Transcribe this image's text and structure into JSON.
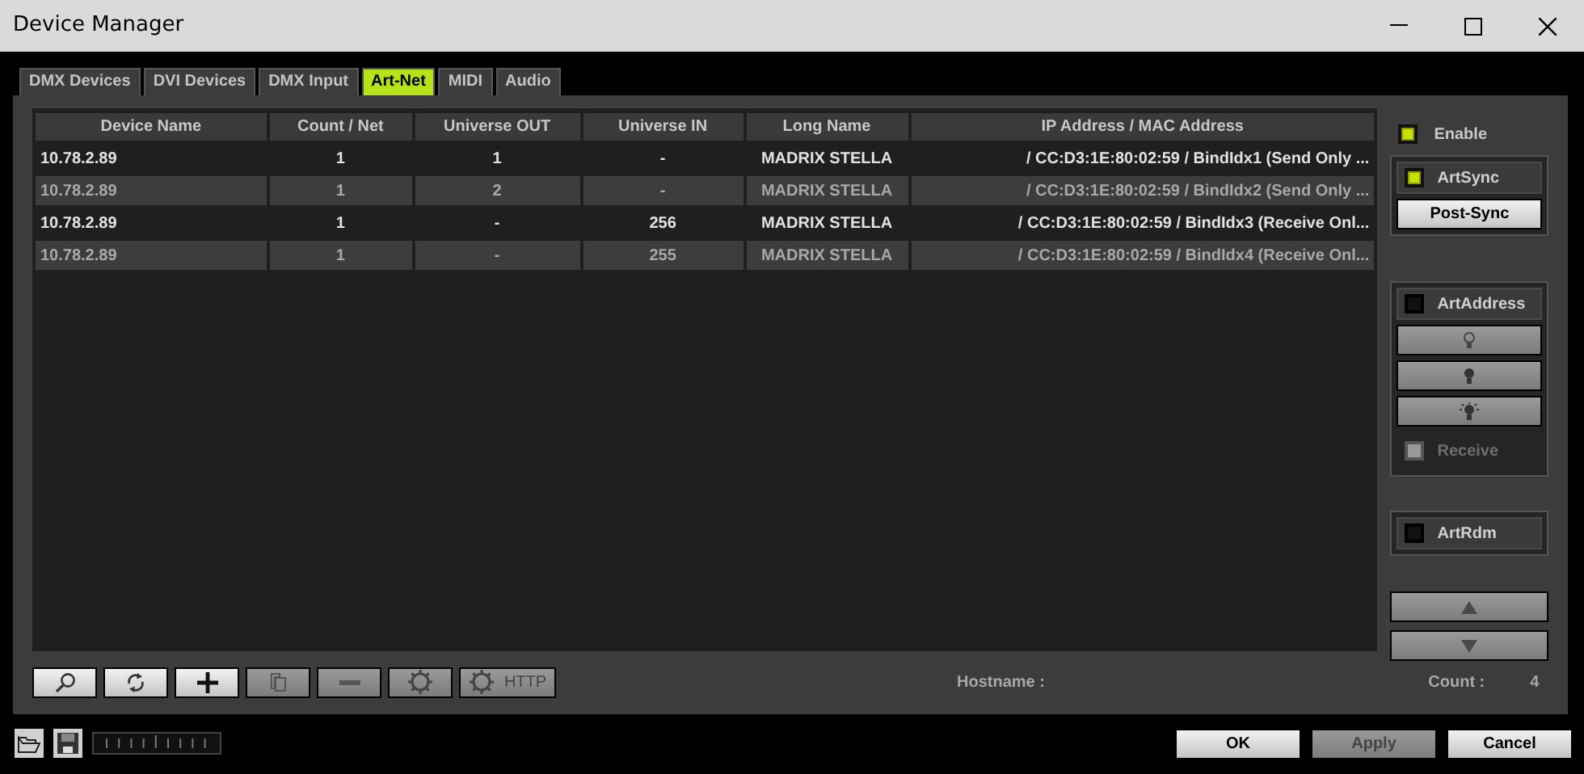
{
  "window": {
    "title": "Device Manager"
  },
  "tabs": [
    {
      "label": "DMX Devices",
      "selected": false
    },
    {
      "label": "DVI Devices",
      "selected": false
    },
    {
      "label": "DMX Input",
      "selected": false
    },
    {
      "label": "Art-Net",
      "selected": true
    },
    {
      "label": "MIDI",
      "selected": false
    },
    {
      "label": "Audio",
      "selected": false
    }
  ],
  "table": {
    "columns": [
      "Device Name",
      "Count / Net",
      "Universe OUT",
      "Universe IN",
      "Long Name",
      "IP Address / MAC Address"
    ],
    "rows": [
      [
        "10.78.2.89",
        "1",
        "1",
        "-",
        "MADRIX STELLA",
        "/ CC:D3:1E:80:02:59 / BindIdx1 (Send Only ..."
      ],
      [
        "10.78.2.89",
        "1",
        "2",
        "-",
        "MADRIX STELLA",
        "/ CC:D3:1E:80:02:59 / BindIdx2 (Send Only ..."
      ],
      [
        "10.78.2.89",
        "1",
        "-",
        "256",
        "MADRIX STELLA",
        "/ CC:D3:1E:80:02:59 / BindIdx3 (Receive Onl..."
      ],
      [
        "10.78.2.89",
        "1",
        "-",
        "255",
        "MADRIX STELLA",
        "/ CC:D3:1E:80:02:59 / BindIdx4 (Receive Onl..."
      ]
    ]
  },
  "toolbar": [
    {
      "kind": "search",
      "disabled": false
    },
    {
      "kind": "refresh",
      "disabled": false
    },
    {
      "kind": "add",
      "disabled": false
    },
    {
      "kind": "copy",
      "disabled": true
    },
    {
      "kind": "remove",
      "disabled": true
    },
    {
      "kind": "gear",
      "disabled": true
    },
    {
      "kind": "gear",
      "label": "HTTP",
      "disabled": true
    }
  ],
  "status": {
    "hostname_label": "Hostname :",
    "count_label": "Count :",
    "count": "4"
  },
  "side": {
    "enable": {
      "label": "Enable",
      "checked": true
    },
    "artsync": {
      "label": "ArtSync",
      "checked": true,
      "button": "Post-Sync"
    },
    "artaddress": {
      "label": "ArtAddress",
      "checked": false,
      "buttons": [
        {
          "kind": "bulb-off",
          "disabled": true
        },
        {
          "kind": "bulb-on",
          "disabled": true
        },
        {
          "kind": "bulb-glow",
          "disabled": true
        }
      ],
      "receive": {
        "label": "Receive",
        "checked": false,
        "disabled": true
      }
    },
    "artrdm": {
      "label": "ArtRdm",
      "checked": false
    },
    "nav": [
      {
        "kind": "up",
        "disabled": true
      },
      {
        "kind": "down",
        "disabled": true
      }
    ]
  },
  "footer": {
    "buttons": [
      {
        "label": "OK",
        "disabled": false
      },
      {
        "label": "Apply",
        "disabled": true
      },
      {
        "label": "Cancel",
        "disabled": false
      }
    ]
  }
}
